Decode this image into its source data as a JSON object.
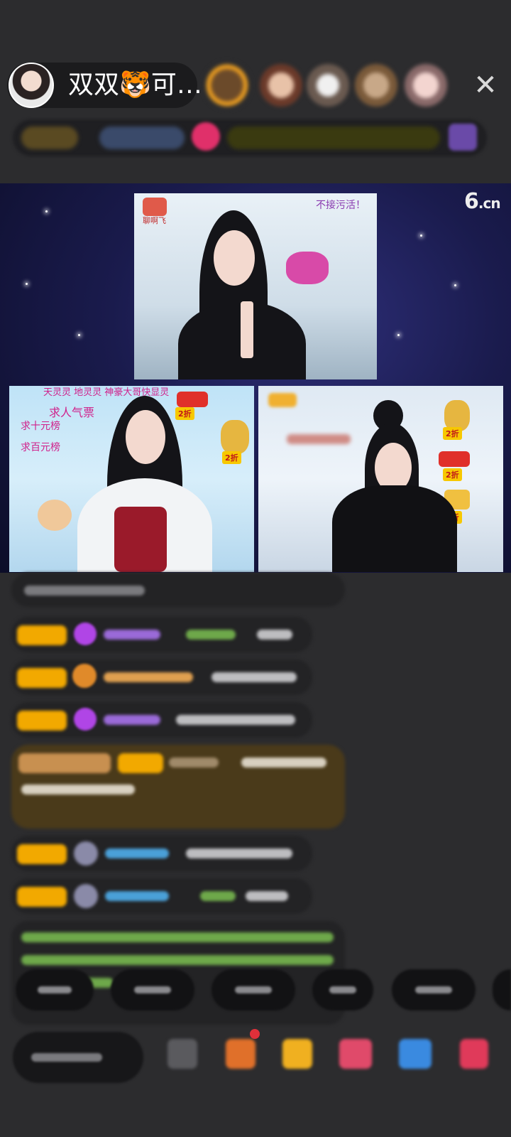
{
  "header": {
    "host_name": "双双🐯可…",
    "close_symbol": "✕"
  },
  "stage": {
    "logo_main": "6",
    "logo_suffix": ".cn",
    "top_video": {
      "brand_tag": "聊啊飞",
      "notice": "不接污活！"
    },
    "left_video": {
      "banner": "天灵灵 地灵灵 神豪大哥快显灵",
      "lines": [
        "求人气票",
        "求十元榜",
        "求百元榜"
      ],
      "discount_labels": [
        "2折",
        "2折"
      ]
    },
    "right_video": {
      "discount_labels": [
        "2折",
        "2折",
        "2折"
      ]
    }
  },
  "colors": {
    "badge": "#f2a900",
    "diamond": "#b045e6",
    "name_purple": "#9a6ad8",
    "name_green": "#6ea84a",
    "name_orange": "#e08a2a",
    "name_blue": "#4aa0d8",
    "highlight_row": "#4a3a1a",
    "stage_bg": "#1a1b4d"
  }
}
